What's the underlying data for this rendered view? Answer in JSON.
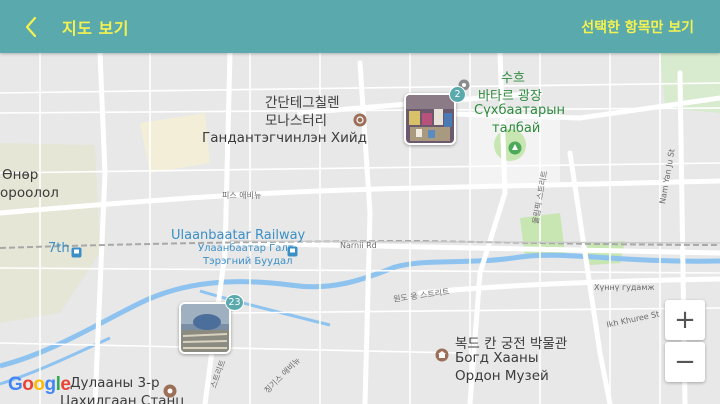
{
  "header": {
    "title": "지도 보기",
    "select_label": "선택한 항목만 보기"
  },
  "map": {
    "places": {
      "monastery_ko_1": "간단테그칠렌",
      "monastery_ko_2": "모나스터리",
      "monastery_mn": "Гандантэгчинлэн Хийд",
      "square_ko_1": "수흐",
      "square_ko_2": "바타르 광장",
      "square_mn_1": "Сүхбаатарын",
      "square_mn_2": "талбай",
      "museum_ko": "복드 칸 궁전 박물관",
      "museum_mn_1": "Богд Хааны",
      "museum_mn_2": "Ордон Музей",
      "railway_en": "Ulaanbaatar Railway",
      "railway_mn_1": "Улаанбаатар Галт",
      "railway_mn_2": "Тэрэгний Буудал",
      "left_1": "Өнөр",
      "left_2": "ороолол",
      "stop_7th": "7th",
      "bottom_mn_1": "Дулааны 3-р",
      "bottom_mn_2": "Цахилгаан Станц"
    },
    "streets": {
      "peace_ave": "피스 애비뉴",
      "narnii_rd": "Narnii Rd",
      "khuhn": "Хүннү гудамж",
      "ikh_khuree": "Ikh Khuree St",
      "ondo": "원도 옹 스트리트",
      "namyanju": "Nam Yan Ju St",
      "olympic": "올림픽 스트리트",
      "chinggis": "칭기스 애비뉴",
      "bottom_st": "스트리트"
    },
    "markers": [
      {
        "name": "photo-cluster-sukhbaatar",
        "count": "2"
      },
      {
        "name": "photo-cluster-railway",
        "count": "23"
      }
    ],
    "zoom_in": "+",
    "zoom_out": "−",
    "logo": [
      "G",
      "o",
      "o",
      "g",
      "l",
      "e"
    ],
    "colors": {
      "header": "#5aa9ad",
      "header_text": "#f5f250",
      "river": "#8ec3f0",
      "park": "#c7e6b2",
      "road": "#ffffff",
      "rail": "#a8a8a8"
    }
  }
}
